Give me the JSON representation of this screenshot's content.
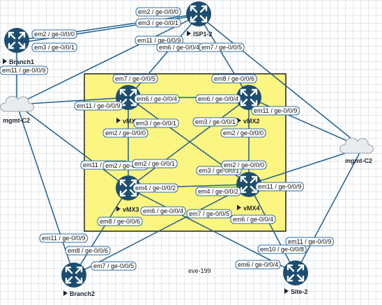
{
  "lab": {
    "name": "eve-199",
    "area_color": "#fbf582"
  },
  "nodes": {
    "isp": {
      "label": "ISP1-2"
    },
    "branch1": {
      "label": "Branch1"
    },
    "branch2": {
      "label": "Branch2"
    },
    "site2": {
      "label": "Site-2"
    },
    "vmx1": {
      "label": "vMX1"
    },
    "vmx2": {
      "label": "vMX2"
    },
    "vmx3": {
      "label": "vMX3"
    },
    "vmx4": {
      "label": "vMX4"
    },
    "mgmt_left": {
      "label": "mgmt-C2"
    },
    "mgmt_right": {
      "label": "mgmt-C2"
    }
  },
  "interfaces": [
    "em2 / ge-0/0/0",
    "em3 / ge-0/0/1",
    "em2 / ge-0/0/0",
    "em3 / ge-0/0/1",
    "em11 / ge-0/0/9",
    "em6 / ge-0/0/4",
    "em7 / ge-0/0/5",
    "em11 / ge-0/0/9",
    "em7 / ge-0/0/5",
    "em8 / ge-0/0/6",
    "em6 / ge-0/0/4",
    "em6 / ge-0/0/4",
    "em11 / ge-0/0/9",
    "em11 / ge-0/0/9",
    "em3 / ge-0/0/1",
    "em3 / ge-0/0/1",
    "em2 / ge-0/0/0",
    "em2 / ge-0/0/0",
    "em11 / ge-0/0/9",
    "em2 / ge-0/0/0",
    "em2 / ge-0/0/1",
    "em3 / ge-0/0/1",
    "em2 / ge-0/0/0",
    "em11 / ge-0/0/9",
    "em4 / ge-0/0/2",
    "em4 / ge-0/0/2",
    "em6 / ge-0/0/4",
    "em7 / ge-0/0/5",
    "em8 / ge-0/0/6",
    "em6 / ge-0/0/4",
    "em11 / ge-0/0/9",
    "em11 / ge-0/0/9",
    "em8 / ge-0/0/6",
    "em10 / ge-0/0/8",
    "em7 / ge-0/0/5",
    "em6 / ge-0/0/4"
  ]
}
